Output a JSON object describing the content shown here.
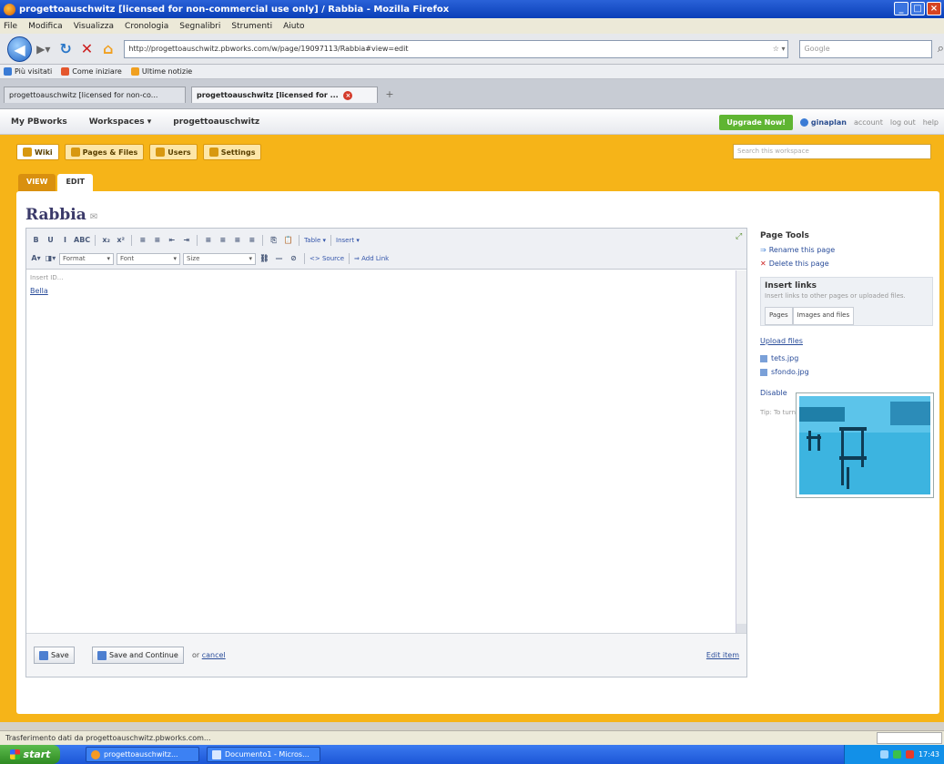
{
  "window": {
    "title": "progettoauschwitz [licensed for non-commercial use only] / Rabbia - Mozilla Firefox",
    "buttons": {
      "min": "_",
      "max": "□",
      "close": "×"
    }
  },
  "menu": [
    "File",
    "Modifica",
    "Visualizza",
    "Cronologia",
    "Segnalibri",
    "Strumenti",
    "Aiuto"
  ],
  "nav": {
    "url": "http://progettoauschwitz.pbworks.com/w/page/19097113/Rabbia#view=edit",
    "search_placeholder": "Google"
  },
  "bookmarks": [
    {
      "label": "Più visitati",
      "color": "#3a7bd5"
    },
    {
      "label": "Come iniziare",
      "color": "#e4572e"
    },
    {
      "label": "Ultime notizie",
      "color": "#f0a020"
    }
  ],
  "browser_tabs": [
    {
      "label": "progettoauschwitz [licensed for non-co...",
      "active": false
    },
    {
      "label": "progettoauschwitz [licensed for ...",
      "active": true
    }
  ],
  "site_header": {
    "items": [
      "My PBworks",
      "Workspaces ▾",
      "progettoauschwitz"
    ],
    "upgrade": "Upgrade Now!",
    "user": "ginaplan",
    "links": [
      "account",
      "log out",
      "help"
    ]
  },
  "wiki_tabs": [
    {
      "label": "Wiki",
      "active": true
    },
    {
      "label": "Pages & Files",
      "active": false
    },
    {
      "label": "Users",
      "active": false
    },
    {
      "label": "Settings",
      "active": false
    }
  ],
  "wiki_search_placeholder": "Search this workspace",
  "view_tabs": [
    {
      "label": "VIEW",
      "active": false
    },
    {
      "label": "EDIT",
      "active": true
    }
  ],
  "page": {
    "title": "Rabbia",
    "rss": "✉"
  },
  "toolbar": {
    "row1": [
      "B",
      "U",
      "I",
      "ABC",
      "x₂",
      "x²",
      "≡",
      "≡",
      "≡",
      "≡",
      "≡",
      "≡",
      "⇤",
      "⇥",
      "⎘",
      "📋"
    ],
    "table": "Table ▾",
    "insert": "Insert ▾",
    "row2_format": "Format",
    "row2_font": "Font",
    "row2_size": "Size",
    "source": "Source",
    "add_link": "Add Link"
  },
  "editor": {
    "start_hint": "Insert ID...",
    "content_link": "Bella"
  },
  "footer": {
    "save": "Save",
    "save_continue": "Save and Continue",
    "or": "or",
    "cancel": "cancel",
    "edit_item": "Edit item"
  },
  "sidebar": {
    "page_tools": "Page Tools",
    "rename": "Rename this page",
    "delete": "Delete this page",
    "insert_links": "Insert links",
    "insert_desc": "Insert links to other pages or uploaded files.",
    "tabs": [
      "Pages",
      "Images and files"
    ],
    "upload": "Upload files",
    "files": [
      "tets.jpg",
      "sfondo.jpg"
    ],
    "misc1": "Disable",
    "misc2": "Tip: To turn text into a link, highlight the text"
  },
  "status": "Trasferimento dati da progettoauschwitz.pbworks.com...",
  "taskbar": {
    "start": "start",
    "tasks": [
      "progettoauschwitz...",
      "Documento1 - Micros..."
    ],
    "clock": "17:43"
  }
}
